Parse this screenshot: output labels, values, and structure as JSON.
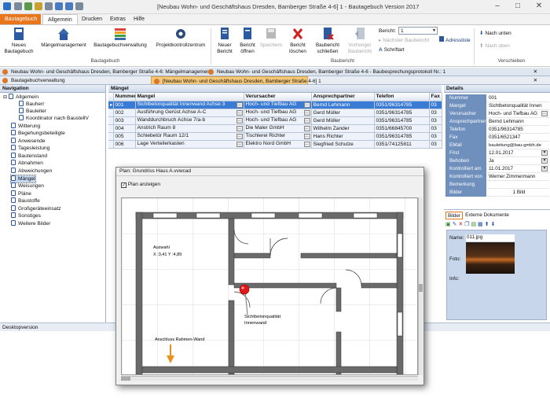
{
  "window": {
    "title": "[Neubau Wohn- und Geschäftshaus Dresden, Bamberger Straße 4-6] 1 - Bautagebuch Version 2017"
  },
  "ribbon_tabs": {
    "file": "Bautagebuch",
    "allgemein": "Allgemein",
    "drucken": "Drucken",
    "extras": "Extras",
    "hilfe": "Hilfe"
  },
  "ribbon": {
    "neues_bautagebuch": "Neues Bautagebuch",
    "maengelmanagement": "Mängelmanagement",
    "bautagebuchverwaltung": "Bautagebuchverwaltung",
    "projektkontrollzentrum": "Projektkontrollzentrum",
    "group_bautagebuch": "Bautagebuch",
    "neuer_bericht": "Neuer Bericht",
    "bericht_oeffnen": "Bericht öffnen",
    "speichern": "Speichern",
    "bericht_loeschen": "Bericht löschen",
    "bauericht_schliessen": "Baubericht schließen",
    "vorheriger_baubericht": "Vorheriger Baubericht",
    "bericht_label": "Bericht:",
    "bericht_value": "1",
    "naechster_baubericht": "Nächster Baubericht",
    "adressliste": "Adressliste",
    "schriftart": "Schriftart",
    "group_bauericht": "Baubericht",
    "nach_unten": "Nach unten",
    "nach_oben": "Nach oben",
    "group_verschieben": "Verschieben"
  },
  "doc_tabs": {
    "tab1": "Neubau Wohn- und Geschäftshaus Dresden, Bamberger Straße 4-6: Mängelmanagement",
    "tab2": "Neubau Wohn- und Geschäftshaus Dresden, Bamberger Straße 4-6 - Baubesprechungsprotokoll Nr.: 1",
    "tab3": "Bautagebuchverwaltung",
    "tab4": "[Neubau Wohn- und Geschäftshaus Dresden, Bamberger Straße 4-6] 1"
  },
  "navigation": {
    "header": "Navigation",
    "items": [
      "Allgemein",
      "Bauherr",
      "Bauleiter",
      "Koordinator nach BaustellV",
      "Witterung",
      "Begehungsbeteiligte",
      "Anwesende",
      "Tagesleistung",
      "Bautenstand",
      "Abnahmen",
      "Abweichungen",
      "Mängel",
      "Weisungen",
      "Pläne",
      "Baustoffe",
      "Großgeräteeinsatz",
      "Sonstiges",
      "Weitere Bilder"
    ]
  },
  "maengel": {
    "header": "Mängel",
    "columns": [
      "Nummer",
      "Mangel",
      "Verursacher",
      "Ansprechpartner",
      "Telefon",
      "Fax"
    ],
    "rows": [
      [
        "001",
        "Sichtbetonqualität Innenwand Achse 3",
        "Hoch- und Tiefbau AG",
        "Bernd Lehmann",
        "0351/96314785",
        "03"
      ],
      [
        "002",
        "Ausführung Gerüst Achse A-C",
        "Hoch- und Tiefbau AG",
        "Gerd Müller",
        "0351/96314785",
        "03"
      ],
      [
        "003",
        "Wanddurchbruch Achse 7/a-b",
        "Hoch- und Tiefbau AG",
        "Gerd Müller",
        "0351/96314785",
        "03"
      ],
      [
        "004",
        "Anstrich Raum 8",
        "Die Maler GmbH",
        "Wilhelm Zander",
        "0351/66845700",
        "03"
      ],
      [
        "005",
        "Schiebetür Raum 12/1",
        "Tischlerei Richter",
        "Hans Richter",
        "0351/96314785",
        "03"
      ],
      [
        "006",
        "Lage Verteilerkasten",
        "Elektro Nord GmbH",
        "Siegfried Schulze",
        "0351/74125811",
        "03"
      ]
    ]
  },
  "details": {
    "header": "Details",
    "fields": [
      {
        "label": "Nummer",
        "value": "001"
      },
      {
        "label": "Mangel",
        "value": "Sichtbetonqualität Innen"
      },
      {
        "label": "Verursacher",
        "value": "Hoch- und Tiefbau AG"
      },
      {
        "label": "Ansprechpartner",
        "value": "Bernd Lehmann"
      },
      {
        "label": "Telefon",
        "value": "0351/96314785"
      },
      {
        "label": "Fax",
        "value": "0351/6521347"
      },
      {
        "label": "EMail",
        "value": "bauleitung@bau-gmbh.de"
      },
      {
        "label": "Frist",
        "value": "12.01.2017"
      },
      {
        "label": "Behoben",
        "value": "Ja"
      },
      {
        "label": "Kontrolliert am",
        "value": "11.01.2017"
      },
      {
        "label": "Kontrolliert von",
        "value": "Werner Zimmermann"
      },
      {
        "label": "Bemerkung",
        "value": ""
      },
      {
        "label": "Bilder",
        "value": "1 Bild"
      }
    ]
  },
  "images": {
    "tab_bilder": "Bilder",
    "tab_externe": "Externe Dokumente",
    "name_label": "Name:",
    "name_value": "011.jpg",
    "foto_label": "Foto:",
    "info_label": "Info:"
  },
  "plan": {
    "title": "Plan: Grundriss Haus A.vvwcad",
    "checkbox_label": "Plan anzeigen",
    "auswahl": "Auswahl",
    "coords": "X :3,41  Y :4,89",
    "marker_label_1": "Sichtbetonqualität",
    "marker_label_2": "Innenwand",
    "arrow_label": "Anschluss Rahmen-Wand"
  },
  "status": {
    "text": "Desktopversion"
  },
  "colors": {
    "accent": "#e8761c",
    "selection": "#3a7bd5",
    "header_blue": "#6f8fbd",
    "marker": "#e01a1a"
  }
}
